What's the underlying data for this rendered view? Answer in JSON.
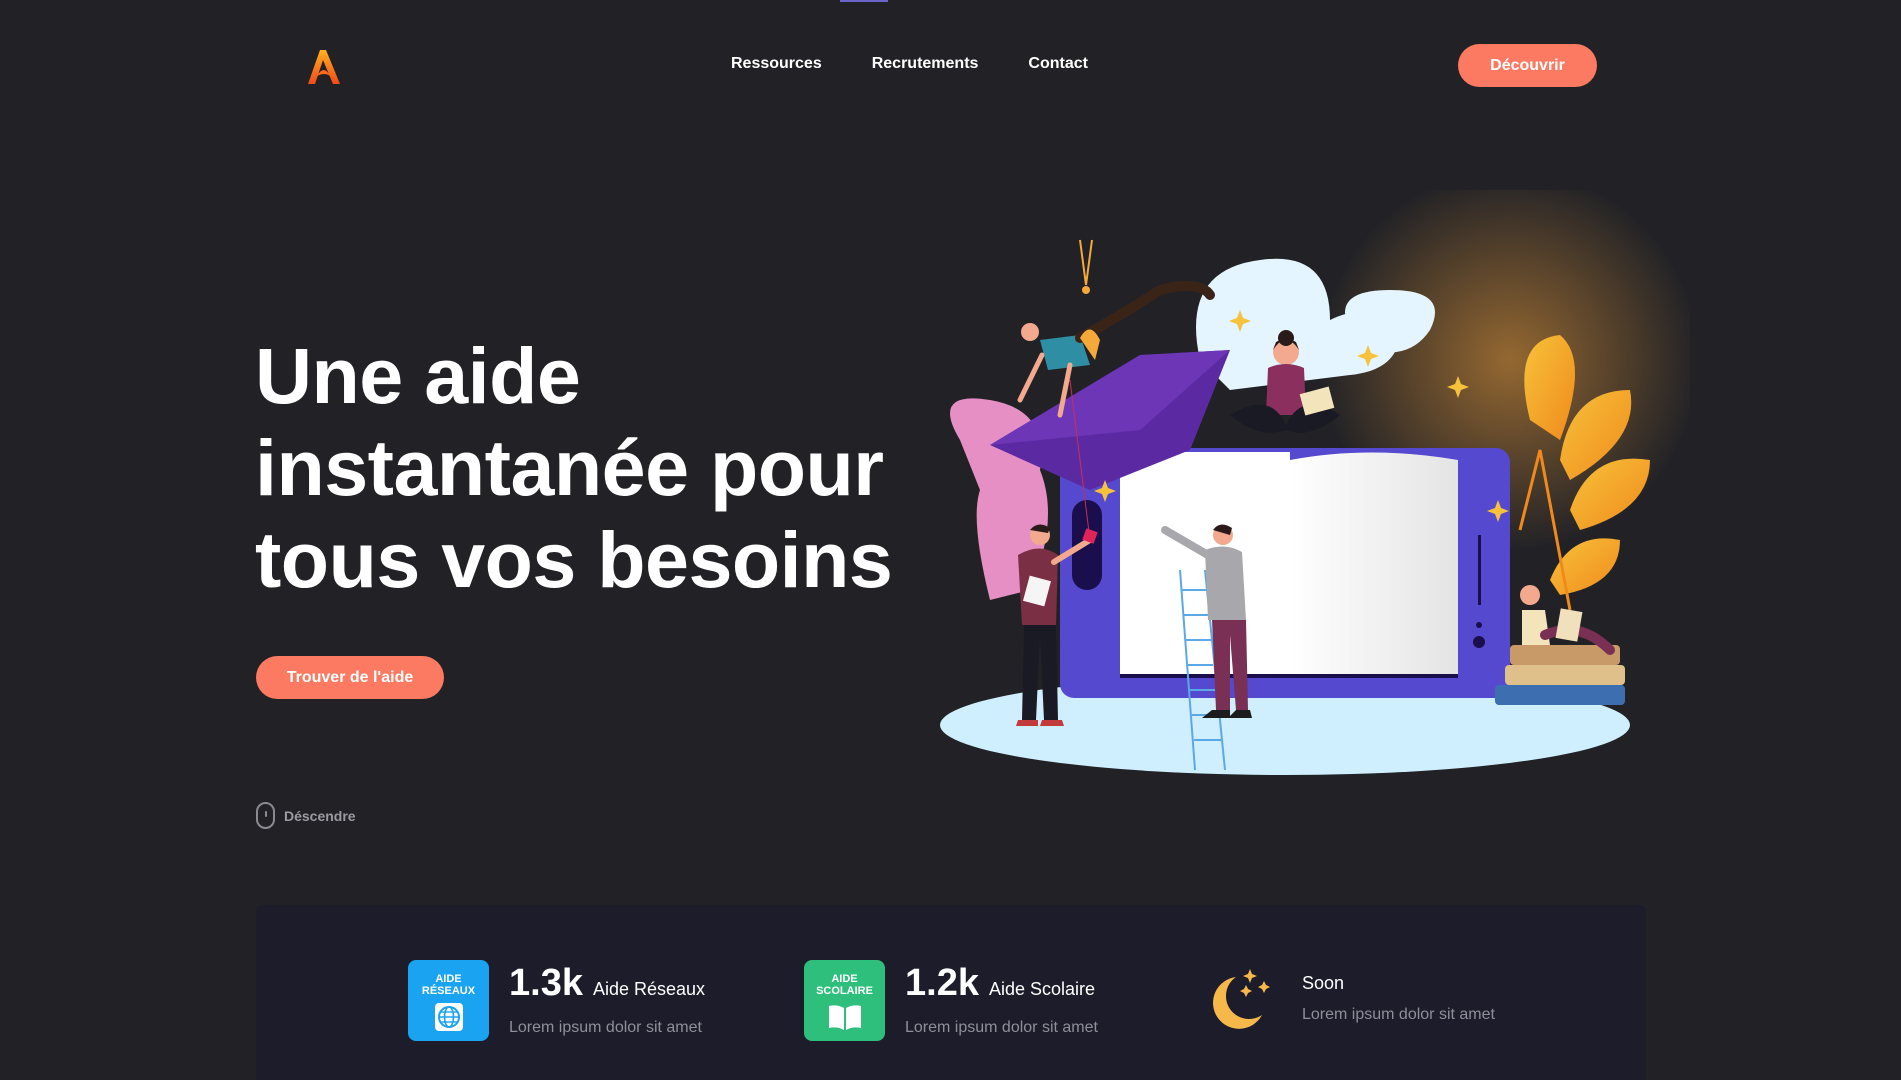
{
  "colors": {
    "background": "#222226",
    "accent": "#fb7a61",
    "stats_panel": "#1c1c2a",
    "badge_network": "#1aa3f0",
    "badge_school": "#2dbf7b",
    "moon": "#f6b84a"
  },
  "header": {
    "logo_icon": "flame-a-logo",
    "nav": [
      "Ressources",
      "Recrutements",
      "Contact"
    ],
    "cta": "Découvrir"
  },
  "hero": {
    "title_lines": [
      "Une aide",
      "instantanée pour",
      "tous vos besoins"
    ],
    "cta": "Trouver de l'aide",
    "scroll_icon": "mouse-icon",
    "scroll_label": "Déscendre",
    "illustration": "education-book-people-illustration"
  },
  "stats": [
    {
      "badge_lines": [
        "AIDE",
        "RÉSEAUX"
      ],
      "badge_icon": "globe-icon",
      "value": "1.3k",
      "label": "Aide Réseaux",
      "sub": "Lorem ipsum dolor sit amet"
    },
    {
      "badge_lines": [
        "AIDE",
        "SCOLAIRE"
      ],
      "badge_icon": "book-icon",
      "value": "1.2k",
      "label": "Aide Scolaire",
      "sub": "Lorem ipsum dolor sit amet"
    },
    {
      "badge_icon": "moon-stars-icon",
      "value": "",
      "label": "Soon",
      "sub": "Lorem ipsum dolor sit amet"
    }
  ]
}
